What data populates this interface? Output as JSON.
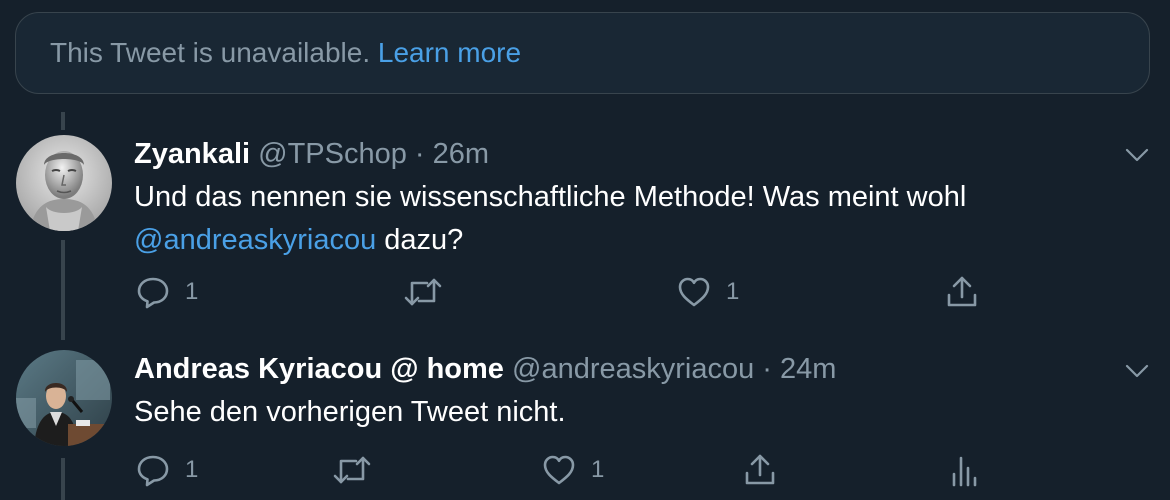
{
  "unavailable_notice": {
    "text": "This Tweet is unavailable.",
    "link_label": "Learn more"
  },
  "tweets": [
    {
      "name": "Zyankali",
      "handle": "@TPSchop",
      "separator": "·",
      "time": "26m",
      "text_before_mention": "Und das nennen sie wissenschaftliche Methode! Was meint wohl",
      "mention": "@andreaskyriacou",
      "text_after_mention": " dazu?",
      "reply_count": "1",
      "retweet_count": "",
      "like_count": "1"
    },
    {
      "name": "Andreas Kyriacou @ home",
      "handle": "@andreaskyriacou",
      "separator": "·",
      "time": "24m",
      "text": "Sehe den vorherigen Tweet nicht.",
      "reply_count": "1",
      "retweet_count": "",
      "like_count": "1"
    }
  ],
  "icons": {
    "reply": "speech-bubble-icon",
    "retweet": "retweet-arrows-icon",
    "like": "heart-icon",
    "share": "share-upload-icon",
    "analytics": "bar-chart-icon",
    "more": "chevron-down-icon"
  },
  "colors": {
    "background": "#15202b",
    "link": "#4aa0e6",
    "muted": "#8899a6",
    "border": "#38444d"
  }
}
